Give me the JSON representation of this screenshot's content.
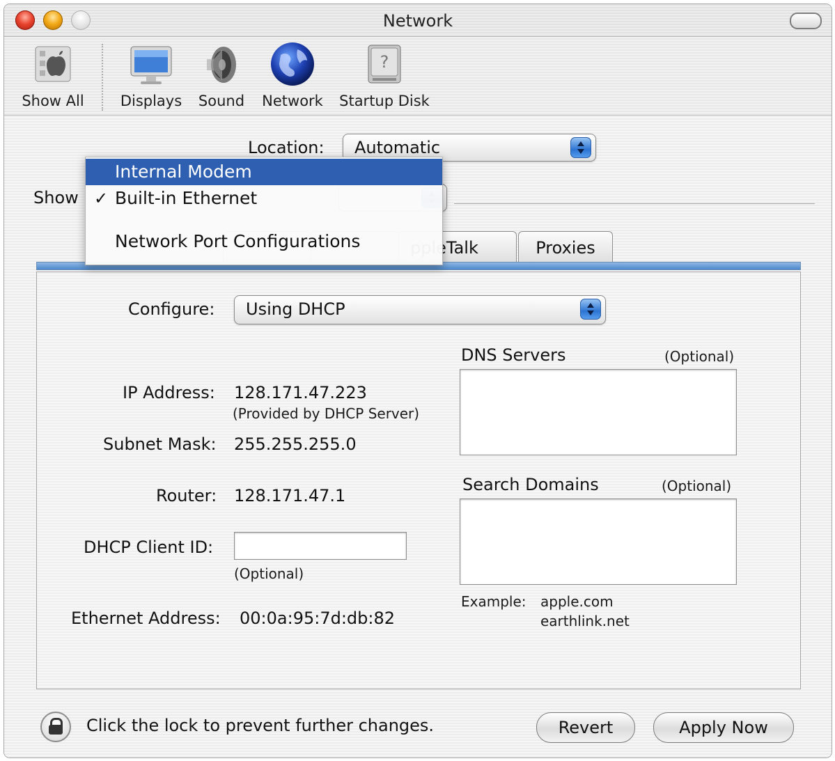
{
  "window": {
    "title": "Network"
  },
  "toolbar": {
    "items": [
      {
        "label": "Show All",
        "icon": "apple-prefs-icon"
      },
      {
        "label": "Displays",
        "icon": "display-icon"
      },
      {
        "label": "Sound",
        "icon": "speaker-icon"
      },
      {
        "label": "Network",
        "icon": "globe-icon"
      },
      {
        "label": "Startup Disk",
        "icon": "hard-disk-icon"
      }
    ]
  },
  "location": {
    "label": "Location:",
    "value": "Automatic"
  },
  "show": {
    "label": "Show"
  },
  "menu": {
    "items": [
      {
        "label": "Internal Modem",
        "selected": true,
        "checked": false
      },
      {
        "label": "Built-in Ethernet",
        "selected": false,
        "checked": true
      },
      {
        "label": "Network Port Configurations",
        "selected": false,
        "checked": false
      }
    ],
    "check_glyph": "✓"
  },
  "tabs": {
    "visible": [
      "AppleTalk",
      "Proxies"
    ],
    "partial_text": "ppleTalk"
  },
  "configure": {
    "label": "Configure:",
    "value": "Using DHCP"
  },
  "ip": {
    "label": "IP Address:",
    "value": "128.171.47.223",
    "note": "(Provided by DHCP Server)"
  },
  "subnet": {
    "label": "Subnet Mask:",
    "value": "255.255.255.0"
  },
  "router": {
    "label": "Router:",
    "value": "128.171.47.1"
  },
  "dhcp_client": {
    "label": "DHCP Client ID:",
    "value": "",
    "note": "(Optional)"
  },
  "ethernet": {
    "label": "Ethernet Address:",
    "value": "00:0a:95:7d:db:82"
  },
  "dns": {
    "label": "DNS Servers",
    "optional": "(Optional)",
    "value": ""
  },
  "search_domains": {
    "label": "Search Domains",
    "optional": "(Optional)",
    "value": ""
  },
  "example": {
    "label": "Example:",
    "line1": "apple.com",
    "line2": "earthlink.net"
  },
  "footer": {
    "lock_text": "Click the lock to prevent further changes.",
    "revert": "Revert",
    "apply": "Apply Now"
  },
  "colors": {
    "selection": "#2e5fb0",
    "accent_blue": "#2c74d3"
  }
}
